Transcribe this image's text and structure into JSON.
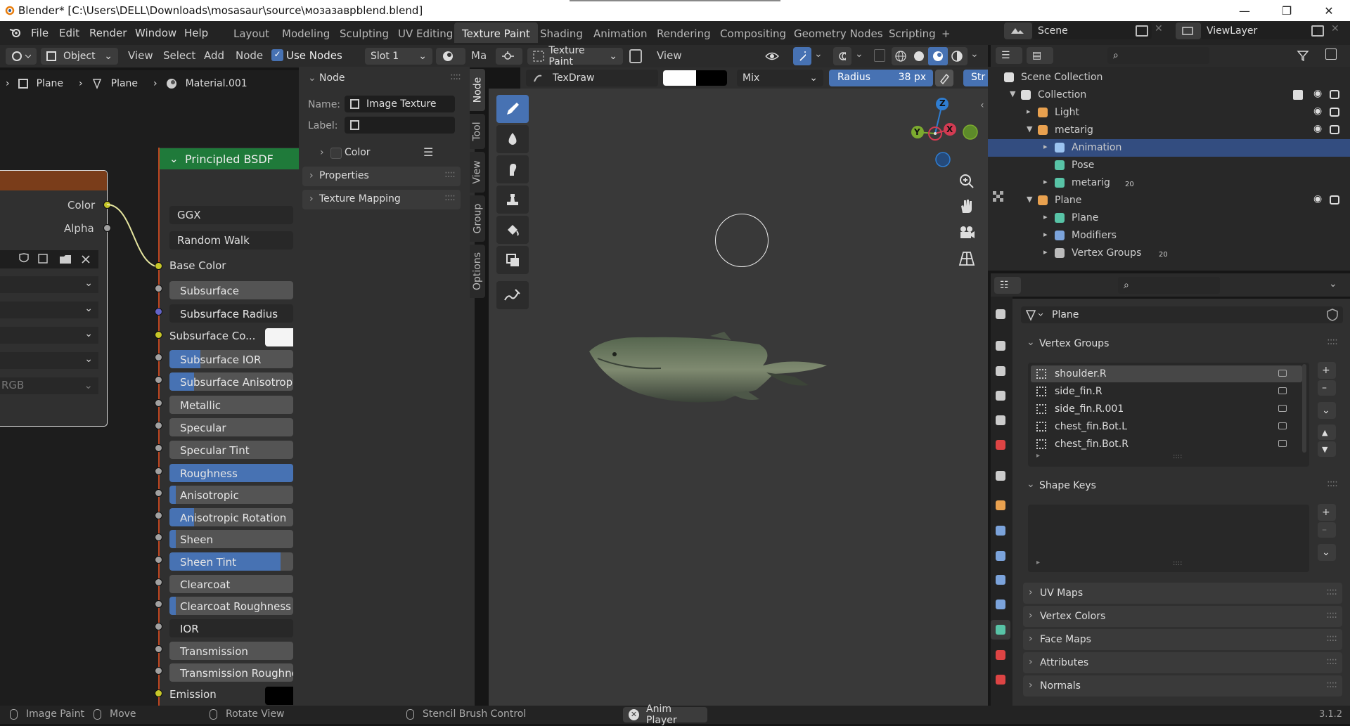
{
  "titlebar": {
    "title": "Blender* [C:\\Users\\DELL\\Downloads\\mosasaur\\source\\мозазаврblend.blend]",
    "minimize": "—",
    "restore": "❐",
    "close": "✕"
  },
  "menu": [
    "File",
    "Edit",
    "Render",
    "Window",
    "Help"
  ],
  "workspaces": [
    "Layout",
    "Modeling",
    "Sculpting",
    "UV Editing",
    "Texture Paint",
    "Shading",
    "Animation",
    "Rendering",
    "Compositing",
    "Geometry Nodes",
    "Scripting",
    "+"
  ],
  "scene": {
    "name": "Scene",
    "viewlayer": "ViewLayer"
  },
  "node_editor": {
    "mode": "Object",
    "menus": [
      "View",
      "Select",
      "Add",
      "Node"
    ],
    "use_nodes": "Use Nodes",
    "slot": "Slot 1",
    "mat_short": "Ma",
    "breadcrumb": [
      "Plane",
      "Plane",
      "Material.001"
    ],
    "tex_node": {
      "outputs": [
        "Color",
        "Alpha"
      ],
      "dropdown_last": "RGB"
    },
    "bsdf": {
      "title": "Principled BSDF",
      "distribution": "GGX",
      "subsurface_method": "Random Walk",
      "base_color": "Base Color",
      "inputs": [
        {
          "label": "Subsurface",
          "fill": 0,
          "color": "#a1a1a1"
        },
        {
          "label": "Subsurface Radius",
          "plain": true,
          "color": "#6363c7"
        },
        {
          "label": "Subsurface Co...",
          "swatch": true,
          "color": "#c7c729"
        },
        {
          "label": "Subsurface IOR",
          "fill": 0.25,
          "color": "#a1a1a1"
        },
        {
          "label": "Subsurface Anisotropy",
          "fill": 0.2,
          "color": "#a1a1a1"
        },
        {
          "label": "Metallic",
          "fill": 0,
          "color": "#a1a1a1"
        },
        {
          "label": "Specular",
          "fill": 0,
          "color": "#a1a1a1"
        },
        {
          "label": "Specular Tint",
          "fill": 0,
          "color": "#a1a1a1"
        },
        {
          "label": "Roughness",
          "fill": 1,
          "color": "#a1a1a1"
        },
        {
          "label": "Anisotropic",
          "fill": 0.05,
          "color": "#a1a1a1"
        },
        {
          "label": "Anisotropic Rotation",
          "fill": 0.2,
          "color": "#a1a1a1"
        },
        {
          "label": "Sheen",
          "fill": 0.05,
          "color": "#a1a1a1"
        },
        {
          "label": "Sheen Tint",
          "fill": 0.9,
          "color": "#a1a1a1"
        },
        {
          "label": "Clearcoat",
          "fill": 0,
          "color": "#a1a1a1"
        },
        {
          "label": "Clearcoat Roughness",
          "fill": 0.05,
          "color": "#a1a1a1"
        },
        {
          "label": "IOR",
          "plain": true,
          "color": "#a1a1a1"
        },
        {
          "label": "Transmission",
          "fill": 0,
          "color": "#a1a1a1"
        },
        {
          "label": "Transmission Roughness",
          "fill": 0,
          "color": "#a1a1a1"
        },
        {
          "label": "Emission",
          "black": true,
          "color": "#c7c729"
        }
      ]
    }
  },
  "sidebar": {
    "section": "Node",
    "name_label": "Name:",
    "name_value": "Image Texture",
    "label_label": "Label:",
    "label_value": "",
    "color": "Color",
    "properties": "Properties",
    "texture_mapping": "Texture Mapping",
    "tabs": [
      "Node",
      "Tool",
      "View",
      "Group",
      "Options"
    ]
  },
  "viewport": {
    "mode": "Texture Paint",
    "view": "View",
    "brush": "TexDraw",
    "blend": "Mix",
    "radius_label": "Radius",
    "radius_value": "38 px",
    "stroke_short": "Str",
    "axis_z": "Z",
    "axis_y": "Y",
    "axis_x": "X"
  },
  "outliner": {
    "rows": [
      {
        "label": "Scene Collection",
        "indent": 0,
        "icon": "collection-icon"
      },
      {
        "label": "Collection",
        "indent": 1,
        "icon": "collection-icon"
      },
      {
        "label": "Light",
        "indent": 2,
        "icon": "light-icon"
      },
      {
        "label": "metarig",
        "indent": 2,
        "icon": "armature-icon"
      },
      {
        "label": "Animation",
        "indent": 3,
        "icon": "animation-icon",
        "selected": true
      },
      {
        "label": "Pose",
        "indent": 3,
        "icon": "pose-icon"
      },
      {
        "label": "metarig",
        "indent": 3,
        "icon": "armature-data-icon",
        "badge": "20"
      },
      {
        "label": "Plane",
        "indent": 2,
        "icon": "mesh-object-icon"
      },
      {
        "label": "Plane",
        "indent": 3,
        "icon": "mesh-data-icon"
      },
      {
        "label": "Modifiers",
        "indent": 3,
        "icon": "wrench-icon"
      },
      {
        "label": "Vertex Groups",
        "indent": 3,
        "icon": "vertex-groups-icon",
        "badge": "20"
      }
    ]
  },
  "properties": {
    "object": "Plane",
    "vertex_groups_title": "Vertex Groups",
    "vertex_groups": [
      "shoulder.R",
      "side_fin.R",
      "side_fin.R.001",
      "chest_fin.Bot.L",
      "chest_fin.Bot.R"
    ],
    "shape_keys": "Shape Keys",
    "sections": [
      "UV Maps",
      "Vertex Colors",
      "Face Maps",
      "Attributes",
      "Normals"
    ]
  },
  "status": {
    "items": [
      "Image Paint",
      "Move",
      "Rotate View",
      "Stencil Brush Control"
    ],
    "anim_player": "Anim Player",
    "version": "3.1.2"
  }
}
